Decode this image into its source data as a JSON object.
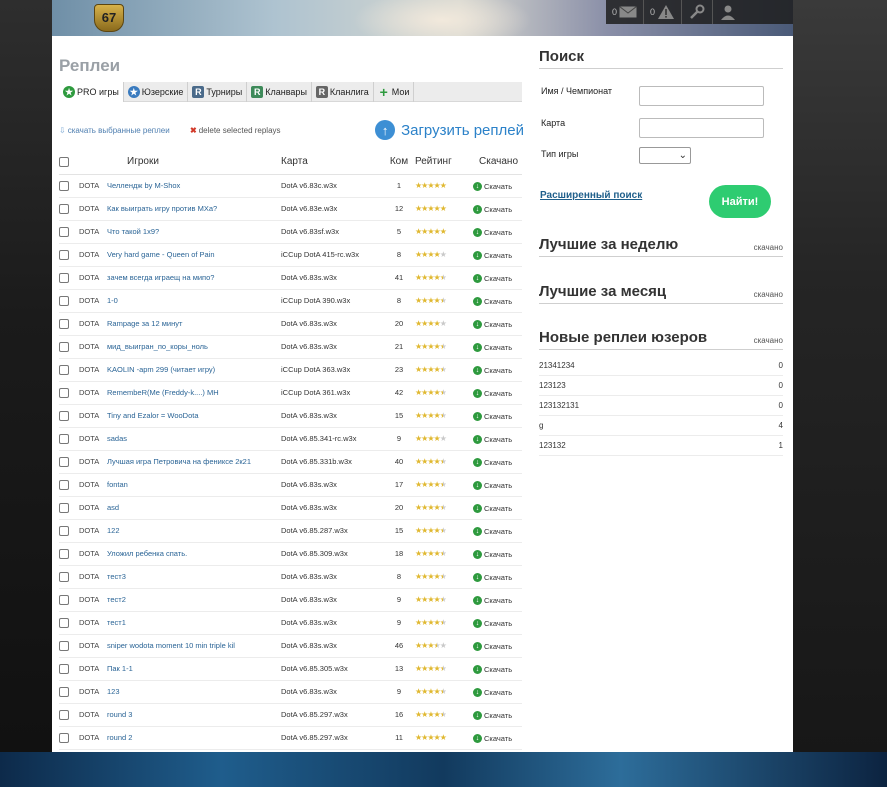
{
  "header": {
    "level": "67",
    "messages_count": "0",
    "alerts_count": "0"
  },
  "page_title": "Реплеи",
  "tabs": [
    {
      "label": "PRO игры",
      "icon": "star-green-icon"
    },
    {
      "label": "Юзерские",
      "icon": "star-blue-icon"
    },
    {
      "label": "Турниры",
      "icon": "r-icon"
    },
    {
      "label": "Кланвары",
      "icon": "r-icon"
    },
    {
      "label": "Кланлига",
      "icon": "r-icon"
    },
    {
      "label": "Мои",
      "icon": "plus-icon"
    }
  ],
  "actions": {
    "download_selected": "скачать выбранные реплеи",
    "delete_selected": "delete selected replays",
    "upload": "Загрузить реплей"
  },
  "table": {
    "columns": [
      "Игроки",
      "Карта",
      "Ком",
      "Рейтинг",
      "Скачано"
    ],
    "download_label": "Скачать",
    "rows": [
      {
        "game": "DOTA",
        "title": "Челлендж by M-Shox",
        "map": "DotA v6.83c.w3x",
        "comments": "1",
        "rating": 5
      },
      {
        "game": "DOTA",
        "title": "Как выиграть игру против МХа?",
        "map": "DotA v6.83e.w3x",
        "comments": "12",
        "rating": 5
      },
      {
        "game": "DOTA",
        "title": "Что такой 1x9?",
        "map": "DotA v6.83sf.w3x",
        "comments": "5",
        "rating": 5
      },
      {
        "game": "DOTA",
        "title": "Very hard game - Queen of Pain",
        "map": "iCCup DotA 415-rc.w3x",
        "comments": "8",
        "rating": 4
      },
      {
        "game": "DOTA",
        "title": "зачем всегда играещ на мипо?",
        "map": "DotA v6.83s.w3x",
        "comments": "41",
        "rating": 4.5
      },
      {
        "game": "DOTA",
        "title": "1-0",
        "map": "iCCup DotA 390.w3x",
        "comments": "8",
        "rating": 4.5
      },
      {
        "game": "DOTA",
        "title": "Rampage за 12 минут",
        "map": "DotA v6.83s.w3x",
        "comments": "20",
        "rating": 4
      },
      {
        "game": "DOTA",
        "title": "мид_выигран_по_коры_ноль",
        "map": "DotA v6.83s.w3x",
        "comments": "21",
        "rating": 4.5
      },
      {
        "game": "DOTA",
        "title": "KAOLIN -apm 299 (читает игру)",
        "map": "iCCup DotA 363.w3x",
        "comments": "23",
        "rating": 4.5
      },
      {
        "game": "DOTA",
        "title": "RemembeR(Me (Freddy-k....) MH",
        "map": "iCCup DotA 361.w3x",
        "comments": "42",
        "rating": 4.5
      },
      {
        "game": "DOTA",
        "title": "Tiny and Ezalor = WooDota",
        "map": "DotA v6.83s.w3x",
        "comments": "15",
        "rating": 4.5
      },
      {
        "game": "DOTA",
        "title": "sadas",
        "map": "DotA v6.85.341-rc.w3x",
        "comments": "9",
        "rating": 4
      },
      {
        "game": "DOTA",
        "title": "Лучшая игра Петровича на фениксе 2к21",
        "map": "DotA v6.85.331b.w3x",
        "comments": "40",
        "rating": 4.5
      },
      {
        "game": "DOTA",
        "title": "fontan",
        "map": "DotA v6.83s.w3x",
        "comments": "17",
        "rating": 4.5
      },
      {
        "game": "DOTA",
        "title": "asd",
        "map": "DotA v6.83s.w3x",
        "comments": "20",
        "rating": 4.5
      },
      {
        "game": "DOTA",
        "title": "122",
        "map": "DotA v6.85.287.w3x",
        "comments": "15",
        "rating": 4.5
      },
      {
        "game": "DOTA",
        "title": "Уложил ребенка спать.",
        "map": "DotA v6.85.309.w3x",
        "comments": "18",
        "rating": 4.5
      },
      {
        "game": "DOTA",
        "title": "тест3",
        "map": "DotA v6.83s.w3x",
        "comments": "8",
        "rating": 4.5
      },
      {
        "game": "DOTA",
        "title": "тест2",
        "map": "DotA v6.83s.w3x",
        "comments": "9",
        "rating": 4.5
      },
      {
        "game": "DOTA",
        "title": "тест1",
        "map": "DotA v6.83s.w3x",
        "comments": "9",
        "rating": 4.5
      },
      {
        "game": "DOTA",
        "title": "sniper wodota moment 10 min triple kil",
        "map": "DotA v6.83s.w3x",
        "comments": "46",
        "rating": 3.5
      },
      {
        "game": "DOTA",
        "title": "Пак 1-1",
        "map": "DotA v6.85.305.w3x",
        "comments": "13",
        "rating": 4.5
      },
      {
        "game": "DOTA",
        "title": "123",
        "map": "DotA v6.83s.w3x",
        "comments": "9",
        "rating": 4.5
      },
      {
        "game": "DOTA",
        "title": "round 3",
        "map": "DotA v6.85.297.w3x",
        "comments": "16",
        "rating": 4.5
      },
      {
        "game": "DOTA",
        "title": "round 2",
        "map": "DotA v6.85.297.w3x",
        "comments": "11",
        "rating": 5
      }
    ]
  },
  "search": {
    "title": "Поиск",
    "name_label": "Имя / Чемпионат",
    "map_label": "Карта",
    "type_label": "Тип игры",
    "advanced": "Расширенный поиск",
    "submit": "Найти!"
  },
  "best_week": {
    "title": "Лучшие за неделю",
    "side": "скачано"
  },
  "best_month": {
    "title": "Лучшие за месяц",
    "side": "скачано"
  },
  "new_user": {
    "title": "Новые реплеи юзеров",
    "side": "скачано",
    "items": [
      {
        "name": "21341234",
        "count": "0"
      },
      {
        "name": "123123",
        "count": "0"
      },
      {
        "name": "123132131",
        "count": "0"
      },
      {
        "name": "g",
        "count": "4"
      },
      {
        "name": "123132",
        "count": "1"
      }
    ]
  }
}
